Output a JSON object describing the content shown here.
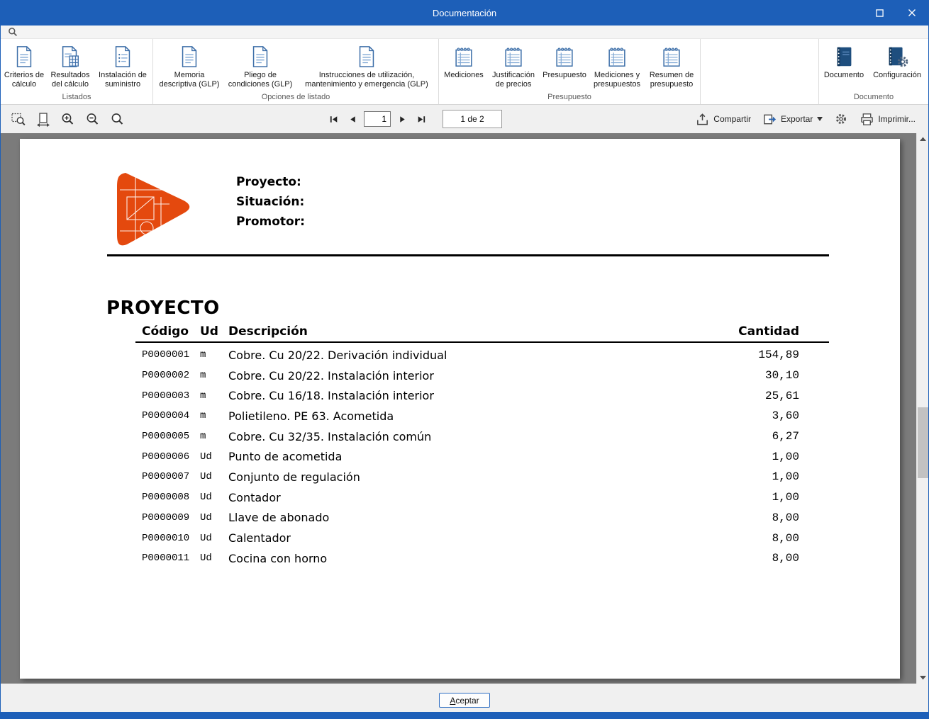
{
  "window": {
    "title": "Documentación"
  },
  "ribbon": {
    "groups": [
      {
        "label": "Listados",
        "buttons": [
          {
            "label": "Criterios de cálculo"
          },
          {
            "label": "Resultados del cálculo"
          },
          {
            "label": "Instalación de suministro"
          }
        ]
      },
      {
        "label": "Opciones de listado",
        "buttons": [
          {
            "label": "Memoria descriptiva (GLP)"
          },
          {
            "label": "Pliego de condiciones (GLP)"
          },
          {
            "label": "Instrucciones de utilización, mantenimiento y emergencia (GLP)"
          }
        ]
      },
      {
        "label": "Presupuesto",
        "buttons": [
          {
            "label": "Mediciones"
          },
          {
            "label": "Justificación de precios"
          },
          {
            "label": "Presupuesto"
          },
          {
            "label": "Mediciones y presupuestos"
          },
          {
            "label": "Resumen de presupuesto"
          }
        ]
      },
      {
        "label": "Documento",
        "buttons": [
          {
            "label": "Documento"
          },
          {
            "label": "Configuración"
          }
        ]
      }
    ]
  },
  "viewbar": {
    "page_field": "1",
    "page_info": "1 de 2",
    "compartir": "Compartir",
    "exportar": "Exportar",
    "imprimir": "Imprimir..."
  },
  "document": {
    "labels": {
      "proyecto": "Proyecto:",
      "situacion": "Situación:",
      "promotor": "Promotor:"
    },
    "heading": "PROYECTO",
    "table": {
      "headers": {
        "codigo": "Código",
        "ud": "Ud",
        "descripcion": "Descripción",
        "cantidad": "Cantidad"
      },
      "rows": [
        {
          "codigo": "P0000001",
          "ud": "m",
          "descripcion": "Cobre. Cu 20/22. Derivación individual",
          "cantidad": "154,89"
        },
        {
          "codigo": "P0000002",
          "ud": "m",
          "descripcion": "Cobre. Cu 20/22. Instalación interior",
          "cantidad": "30,10"
        },
        {
          "codigo": "P0000003",
          "ud": "m",
          "descripcion": "Cobre. Cu 16/18. Instalación interior",
          "cantidad": "25,61"
        },
        {
          "codigo": "P0000004",
          "ud": "m",
          "descripcion": "Polietileno. PE 63. Acometida",
          "cantidad": "3,60"
        },
        {
          "codigo": "P0000005",
          "ud": "m",
          "descripcion": "Cobre. Cu 32/35. Instalación común",
          "cantidad": "6,27"
        },
        {
          "codigo": "P0000006",
          "ud": "Ud",
          "descripcion": "Punto de acometida",
          "cantidad": "1,00"
        },
        {
          "codigo": "P0000007",
          "ud": "Ud",
          "descripcion": "Conjunto de regulación",
          "cantidad": "1,00"
        },
        {
          "codigo": "P0000008",
          "ud": "Ud",
          "descripcion": "Contador",
          "cantidad": "1,00"
        },
        {
          "codigo": "P0000009",
          "ud": "Ud",
          "descripcion": "Llave de abonado",
          "cantidad": "8,00"
        },
        {
          "codigo": "P0000010",
          "ud": "Ud",
          "descripcion": "Calentador",
          "cantidad": "8,00"
        },
        {
          "codigo": "P0000011",
          "ud": "Ud",
          "descripcion": "Cocina con horno",
          "cantidad": "8,00"
        }
      ]
    }
  },
  "footer": {
    "accept_key": "A",
    "accept_rest": "ceptar"
  },
  "icons": {
    "search": "magnifier",
    "zoom_selection": "magnifier-over-region",
    "fit_width": "page-with-horizontal-arrows",
    "zoom_in": "magnifier-plus",
    "zoom_out": "magnifier-minus",
    "zoom_full": "magnifier",
    "share": "share-tray",
    "export": "box-arrow-right",
    "settings": "gear",
    "print": "printer",
    "maximize": "square-outline",
    "close": "x-glyph"
  },
  "colors": {
    "titlebar_blue": "#1d5fb8",
    "logo_orange": "#e4490e",
    "preview_gray": "#7b7b7b",
    "icon_blue": "#3c6ea8"
  }
}
